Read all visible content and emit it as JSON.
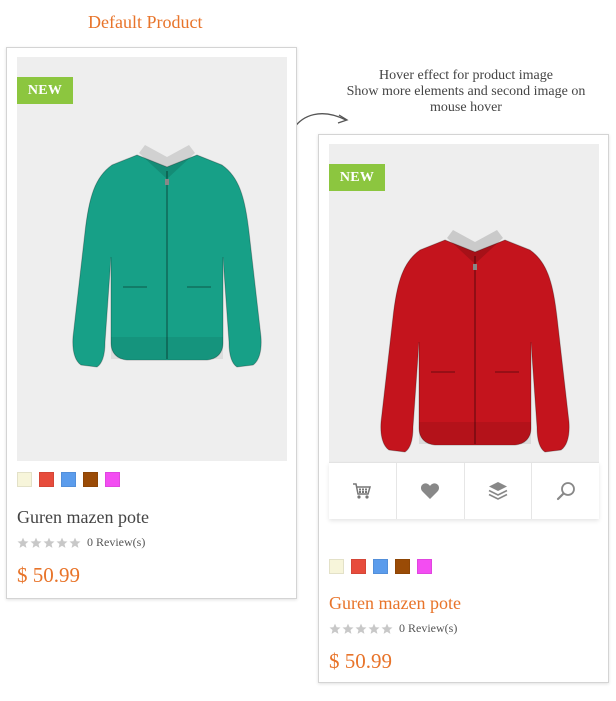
{
  "captions": {
    "default": "Default Product",
    "hover_line1": "Hover effect for product image",
    "hover_line2": "Show more elements and second image on",
    "hover_line3": "mouse hover"
  },
  "products": [
    {
      "badge": "NEW",
      "jacket_color": "#17a087",
      "swatches": [
        "#f7f5da",
        "#e74c3c",
        "#5b9cec",
        "#9a4b06",
        "#f34df2"
      ],
      "title": "Guren mazen pote",
      "reviews": "0 Review(s)",
      "price": "$ 50.99",
      "rating": 0
    },
    {
      "badge": "NEW",
      "jacket_color": "#c4141d",
      "swatches": [
        "#f7f5da",
        "#e74c3c",
        "#5b9cec",
        "#9a4b06",
        "#f34df2"
      ],
      "title": "Guren mazen pote",
      "reviews": "0 Review(s)",
      "price": "$ 50.99",
      "rating": 0,
      "actions": [
        "cart-icon",
        "heart-icon",
        "layers-icon",
        "search-icon"
      ]
    }
  ],
  "colors": {
    "accent": "#e8742a",
    "badge": "#8cc63f",
    "image_bg": "#eeeeee"
  }
}
